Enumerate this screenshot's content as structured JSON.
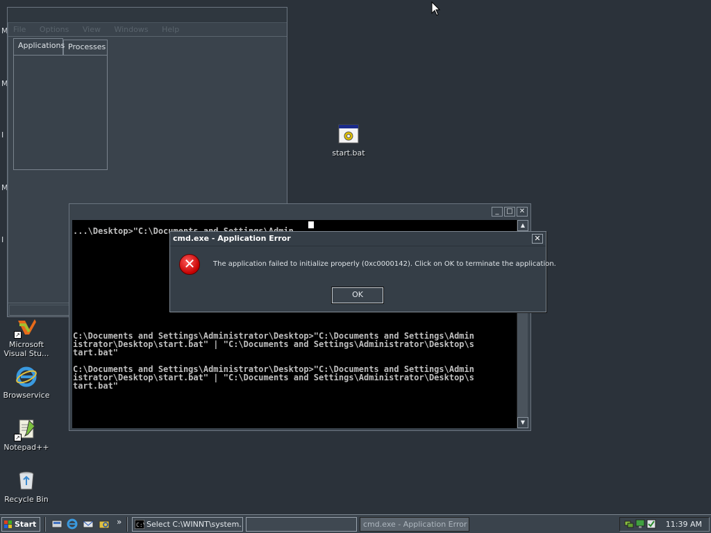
{
  "desktop": {
    "edge_letters": [
      "M",
      "M",
      "I",
      "M",
      "I"
    ],
    "icons": [
      {
        "name": "start-bat",
        "label": "start.bat"
      },
      {
        "name": "visual-studio",
        "label": "Microsoft Visual Stu..."
      },
      {
        "name": "browservice",
        "label": "Browservice"
      },
      {
        "name": "notepad-plus",
        "label": "Notepad++"
      },
      {
        "name": "recycle-bin",
        "label": "Recycle Bin"
      }
    ]
  },
  "task_manager": {
    "menu": [
      "File",
      "Options",
      "View",
      "Windows",
      "Help"
    ],
    "tabs": [
      "Applications",
      "Processes"
    ]
  },
  "cmd_window": {
    "top_line": "...\\Desktop>\"C:\\Documents and Settings\\Admin",
    "lines": [
      "        ",
      "",
      "C:\\Documents and Settings\\Administrator\\Desktop>\"C:\\Documents and Settings\\Admin",
      "istrator\\Desktop\\start.bat\" | \"C:\\Documents and Settings\\Administrator\\Desktop\\s",
      "tart.bat\"",
      "",
      "C:\\Documents and Settings\\Administrator\\Desktop>\"C:\\Documents and Settings\\Admin",
      "istrator\\Desktop\\start.bat\" | \"C:\\Documents and Settings\\Administrator\\Desktop\\s",
      "tart.bat\""
    ]
  },
  "error_dialog": {
    "title": "cmd.exe - Application Error",
    "message": "The application failed to initialize properly (0xc0000142). Click on OK to terminate the application.",
    "ok_label": "OK",
    "close_label": "✕"
  },
  "taskbar": {
    "start_label": "Start",
    "overflow_label": "»",
    "tasks": [
      {
        "label": "Select C:\\WINNT\\system..."
      },
      {
        "label": ""
      },
      {
        "label": "cmd.exe - Application Error"
      }
    ],
    "clock": "11:39 AM"
  }
}
